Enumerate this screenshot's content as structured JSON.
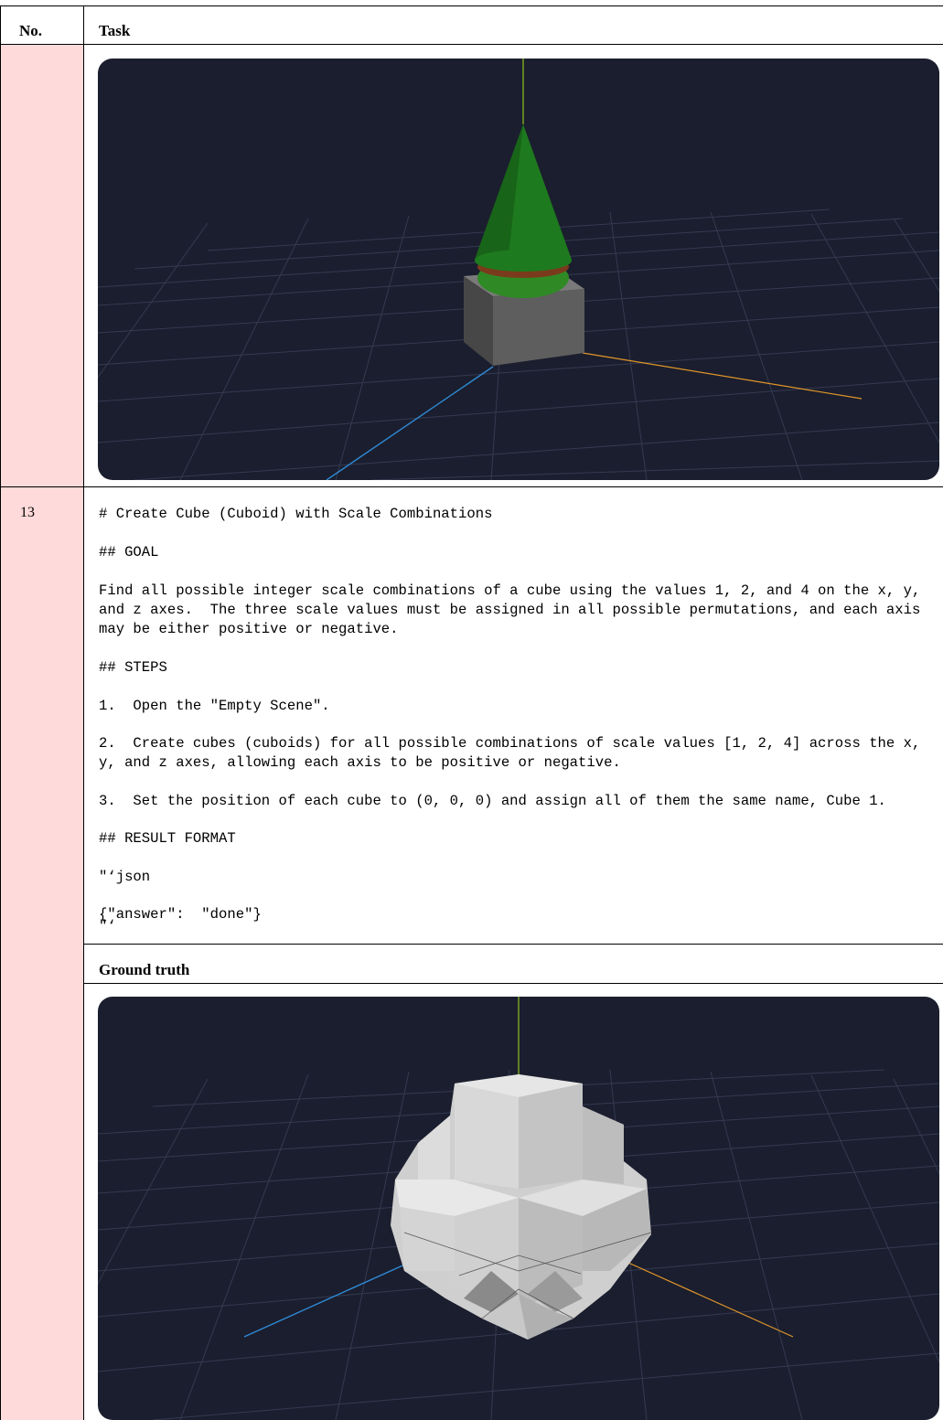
{
  "table": {
    "header_no": "No.",
    "header_task": "Task",
    "row_number": "13",
    "ground_truth_label": "Ground truth"
  },
  "task_text": {
    "title": "# Create Cube (Cuboid) with Scale Combinations",
    "goal_heading": "## GOAL",
    "goal_body": "Find all possible integer scale combinations of a cube using the values 1, 2, and 4 on the x, y, and z axes.  The three scale values must be assigned in all possible permutations, and each axis may be either positive or negative.",
    "steps_heading": "## STEPS",
    "step1": "1.  Open the \"Empty Scene\".",
    "step2": "2.  Create cubes (cuboids) for all possible combinations of scale values [1, 2, 4] across the x, y, and z axes, allowing each axis to be positive or negative.",
    "step3": "3.  Set the position of each cube to (0, 0, 0) and assign all of them the same name, Cube 1.",
    "result_heading": "## RESULT FORMAT",
    "code_open": "\"‘json",
    "code_body": "{\"answer\":  \"done\"}",
    "code_close": "\"‘"
  },
  "scene_colors": {
    "background": "#1b1e2e",
    "grid": "#3a3f55",
    "axis_x": "#e0962a",
    "axis_y": "#8fc21e",
    "axis_z": "#2e8ad6",
    "cone": "#1f7a1f",
    "box": "#5a5a5a",
    "cuboids": "#d9d9d9"
  }
}
